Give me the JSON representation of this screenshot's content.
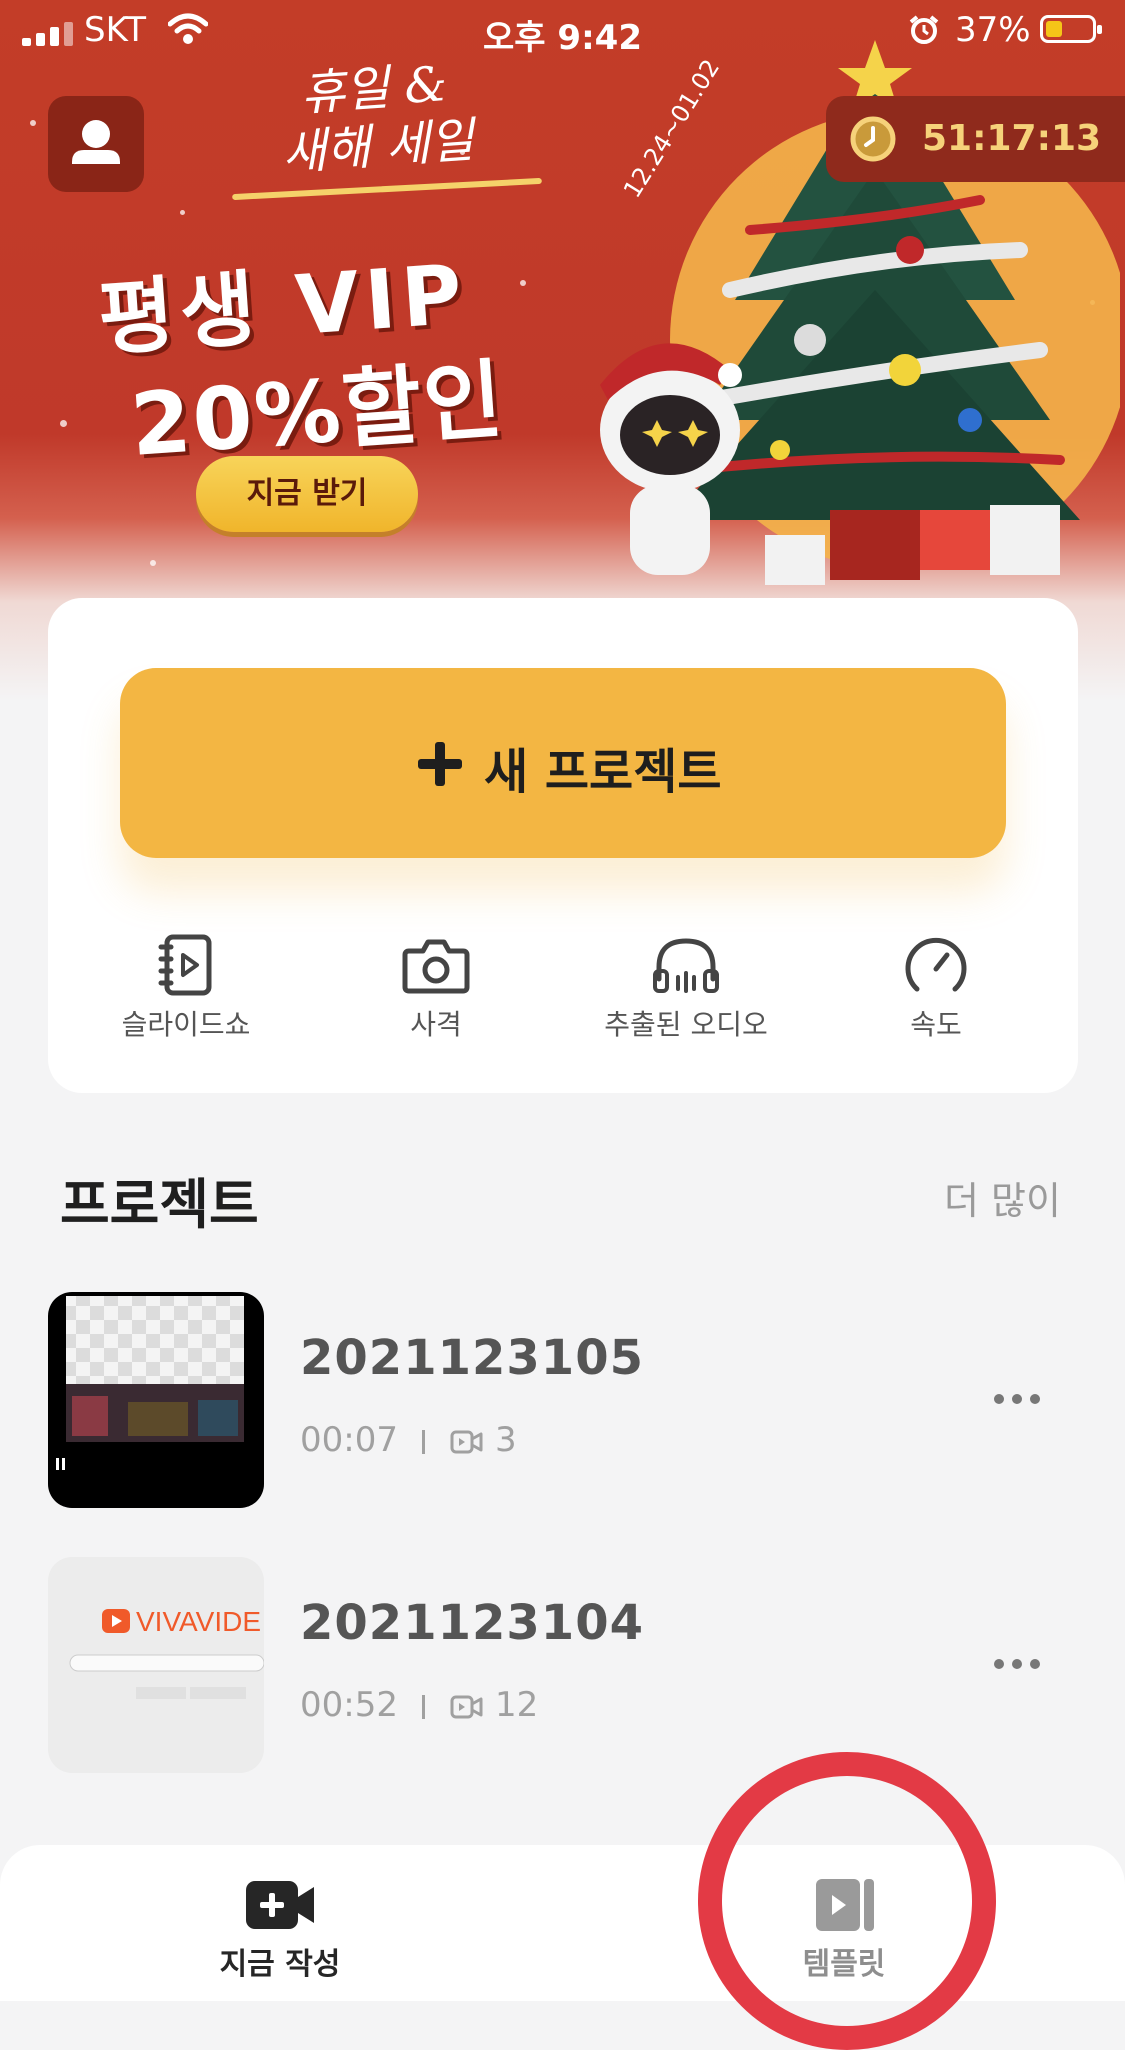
{
  "status_bar": {
    "carrier": "SKT",
    "time": "오후 9:42",
    "battery_pct": "37%",
    "battery_level": 0.37,
    "icons": [
      "signal-icon",
      "wifi-icon",
      "alarm-icon",
      "battery-icon"
    ]
  },
  "banner": {
    "sale_line1": "휴일 &",
    "sale_line2": "새해 세일",
    "date_range": "12.24~01.02",
    "promo_line1": "평생 VIP",
    "promo_line2": "20%할인",
    "cta_label": "지금 받기",
    "countdown": "51:17:13"
  },
  "main_card": {
    "new_project_label": "새 프로젝트",
    "tools": [
      {
        "label": "슬라이드쇼",
        "icon": "slideshow-icon"
      },
      {
        "label": "사격",
        "icon": "camera-icon"
      },
      {
        "label": "추출된 오디오",
        "icon": "headphones-icon"
      },
      {
        "label": "속도",
        "icon": "speed-gauge-icon"
      }
    ]
  },
  "projects": {
    "title": "프로젝트",
    "more_label": "더 많이",
    "items": [
      {
        "name": "2021123105",
        "duration": "00:07",
        "clip_count": "3"
      },
      {
        "name": "2021123104",
        "duration": "00:52",
        "clip_count": "12"
      }
    ],
    "thumb2_brand": "VIVAVIDE"
  },
  "tabbar": {
    "tabs": [
      {
        "label": "지금 작성",
        "icon": "add-video-icon",
        "active": true
      },
      {
        "label": "템플릿",
        "icon": "template-icon",
        "active": false
      }
    ]
  },
  "colors": {
    "banner_red": "#c33d28",
    "accent_yellow": "#f3b643",
    "highlight_ring": "#e33a45",
    "background": "#f4f4f5"
  }
}
